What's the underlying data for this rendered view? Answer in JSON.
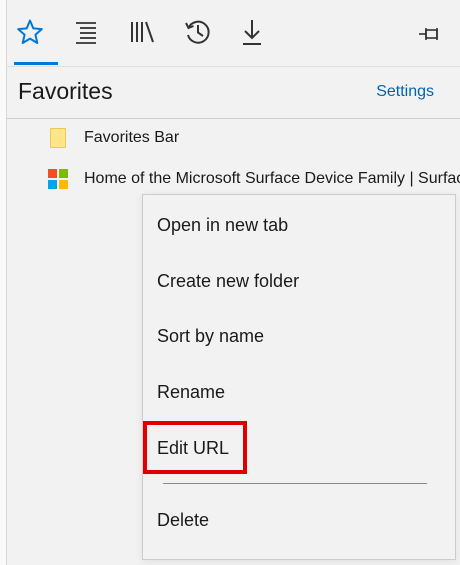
{
  "toolbar": {
    "buttons": [
      "favorites-star-icon",
      "reading-list-icon",
      "books-icon",
      "history-icon",
      "downloads-icon",
      "pin-icon"
    ],
    "accent_color": "#0078d7"
  },
  "panel": {
    "title": "Favorites",
    "settings_label": "Settings"
  },
  "favorites": [
    {
      "label": "Favorites Bar",
      "icon": "folder-icon"
    },
    {
      "label": "Home of the Microsoft Surface Device Family | Surface",
      "icon": "microsoft-logo-icon"
    }
  ],
  "context_menu": {
    "items": [
      {
        "label": "Open in new tab"
      },
      {
        "label": "Create new folder"
      },
      {
        "label": "Sort by name"
      },
      {
        "label": "Rename"
      },
      {
        "label": "Edit URL"
      },
      {
        "label": "Delete"
      }
    ],
    "highlighted_item": "Edit URL",
    "highlight_color": "#e10000"
  }
}
